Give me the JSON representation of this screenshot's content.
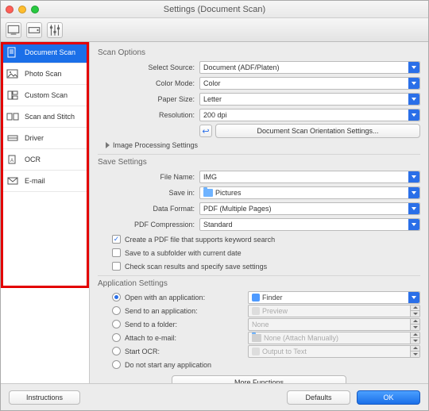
{
  "window": {
    "title": "Settings (Document Scan)"
  },
  "sidebar": {
    "items": [
      {
        "label": "Document Scan",
        "icon": "doc",
        "selected": true
      },
      {
        "label": "Photo Scan",
        "icon": "photo"
      },
      {
        "label": "Custom Scan",
        "icon": "custom"
      },
      {
        "label": "Scan and Stitch",
        "icon": "stitch"
      },
      {
        "label": "Driver",
        "icon": "driver"
      },
      {
        "label": "OCR",
        "icon": "ocr"
      },
      {
        "label": "E-mail",
        "icon": "email"
      }
    ]
  },
  "scan_options": {
    "heading": "Scan Options",
    "select_source": {
      "label": "Select Source:",
      "value": "Document (ADF/Platen)"
    },
    "color_mode": {
      "label": "Color Mode:",
      "value": "Color"
    },
    "paper_size": {
      "label": "Paper Size:",
      "value": "Letter"
    },
    "resolution": {
      "label": "Resolution:",
      "value": "200 dpi"
    },
    "orientation_button": "Document Scan Orientation Settings...",
    "image_processing": "Image Processing Settings"
  },
  "save_settings": {
    "heading": "Save Settings",
    "file_name": {
      "label": "File Name:",
      "value": "IMG"
    },
    "save_in": {
      "label": "Save in:",
      "value": "Pictures"
    },
    "data_format": {
      "label": "Data Format:",
      "value": "PDF (Multiple Pages)"
    },
    "pdf_compression": {
      "label": "PDF Compression:",
      "value": "Standard"
    },
    "chk_keyword": {
      "label": "Create a PDF file that supports keyword search",
      "checked": true
    },
    "chk_subfolder": {
      "label": "Save to a subfolder with current date",
      "checked": false
    },
    "chk_checkresults": {
      "label": "Check scan results and specify save settings",
      "checked": false
    }
  },
  "app_settings": {
    "heading": "Application Settings",
    "open_with": {
      "label": "Open with an application:",
      "value": "Finder",
      "selected": true
    },
    "send_app": {
      "label": "Send to an application:",
      "value": "Preview",
      "selected": false
    },
    "send_folder": {
      "label": "Send to a folder:",
      "value": "None",
      "selected": false
    },
    "attach_email": {
      "label": "Attach to e-mail:",
      "value": "None (Attach Manually)",
      "selected": false
    },
    "start_ocr": {
      "label": "Start OCR:",
      "value": "Output to Text",
      "selected": false
    },
    "do_not_start": {
      "label": "Do not start any application",
      "selected": false
    },
    "more_functions": "More Functions"
  },
  "footer": {
    "instructions": "Instructions",
    "defaults": "Defaults",
    "ok": "OK"
  }
}
